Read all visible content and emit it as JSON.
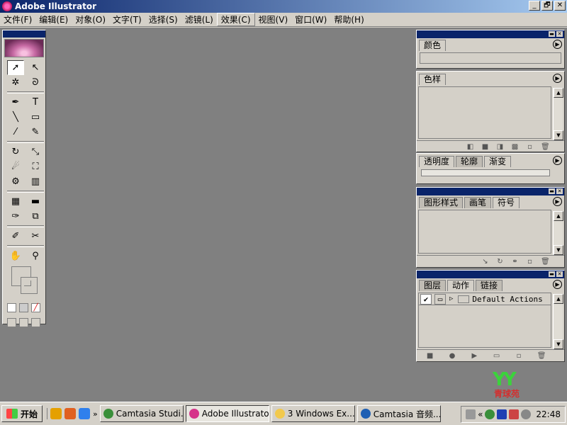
{
  "window": {
    "title": "Adobe Illustrator",
    "buttons": [
      "_",
      "🗗",
      "✕"
    ]
  },
  "menu": [
    "文件(F)",
    "编辑(E)",
    "对象(O)",
    "文字(T)",
    "选择(S)",
    "滤镜(L)",
    "效果(C)",
    "视图(V)",
    "窗口(W)",
    "帮助(H)"
  ],
  "toolbox": {
    "tools": [
      {
        "name": "selection-tool-icon",
        "glyph": "➚"
      },
      {
        "name": "direct-selection-tool-icon",
        "glyph": "↖"
      },
      {
        "name": "magic-wand-tool-icon",
        "glyph": "✲"
      },
      {
        "name": "lasso-tool-icon",
        "glyph": "ᘐ"
      },
      {
        "name": "pen-tool-icon",
        "glyph": "✒"
      },
      {
        "name": "type-tool-icon",
        "glyph": "T"
      },
      {
        "name": "line-tool-icon",
        "glyph": "╲"
      },
      {
        "name": "rectangle-tool-icon",
        "glyph": "▭"
      },
      {
        "name": "paintbrush-tool-icon",
        "glyph": "⁄"
      },
      {
        "name": "pencil-tool-icon",
        "glyph": "✎"
      },
      {
        "name": "rotate-tool-icon",
        "glyph": "↻"
      },
      {
        "name": "scale-tool-icon",
        "glyph": "⤡"
      },
      {
        "name": "warp-tool-icon",
        "glyph": "☄"
      },
      {
        "name": "free-transform-tool-icon",
        "glyph": "⛶"
      },
      {
        "name": "symbol-sprayer-tool-icon",
        "glyph": "⚙"
      },
      {
        "name": "graph-tool-icon",
        "glyph": "▥"
      },
      {
        "name": "mesh-tool-icon",
        "glyph": "▦"
      },
      {
        "name": "gradient-tool-icon",
        "glyph": "▬"
      },
      {
        "name": "eyedropper-tool-icon",
        "glyph": "✑"
      },
      {
        "name": "blend-tool-icon",
        "glyph": "⧉"
      },
      {
        "name": "slice-tool-icon",
        "glyph": "✐"
      },
      {
        "name": "scissors-tool-icon",
        "glyph": "✂"
      },
      {
        "name": "hand-tool-icon",
        "glyph": "✋"
      },
      {
        "name": "zoom-tool-icon",
        "glyph": "⚲"
      }
    ],
    "selected": "selection-tool-icon"
  },
  "panels": {
    "color": {
      "tabs": [
        "颜色"
      ]
    },
    "swatches": {
      "tabs": [
        "色样"
      ]
    },
    "transparency": {
      "tabs": [
        "透明度",
        "轮廓",
        "渐变"
      ]
    },
    "graphic_styles": {
      "tabs": [
        "图形样式",
        "画笔",
        "符号"
      ]
    },
    "layers": {
      "tabs": [
        "图层",
        "动作",
        "链接"
      ],
      "actions": [
        {
          "label": "Default Actions",
          "checked": true
        }
      ]
    }
  },
  "logo": {
    "mark": "YY",
    "text": "青球苑"
  },
  "taskbar": {
    "start_label": "开始",
    "tasks": [
      {
        "label": "Camtasia Studi...",
        "icon_color": "#3a8f3a",
        "active": false
      },
      {
        "label": "Adobe Illustrator",
        "icon_color": "#d6338a",
        "active": true
      },
      {
        "label": "3 Windows Ex...",
        "icon_color": "#f2c94c",
        "active": false
      },
      {
        "label": "Camtasia 音频...",
        "icon_color": "#1e5fb3",
        "active": false
      }
    ],
    "clock": "22:48"
  }
}
